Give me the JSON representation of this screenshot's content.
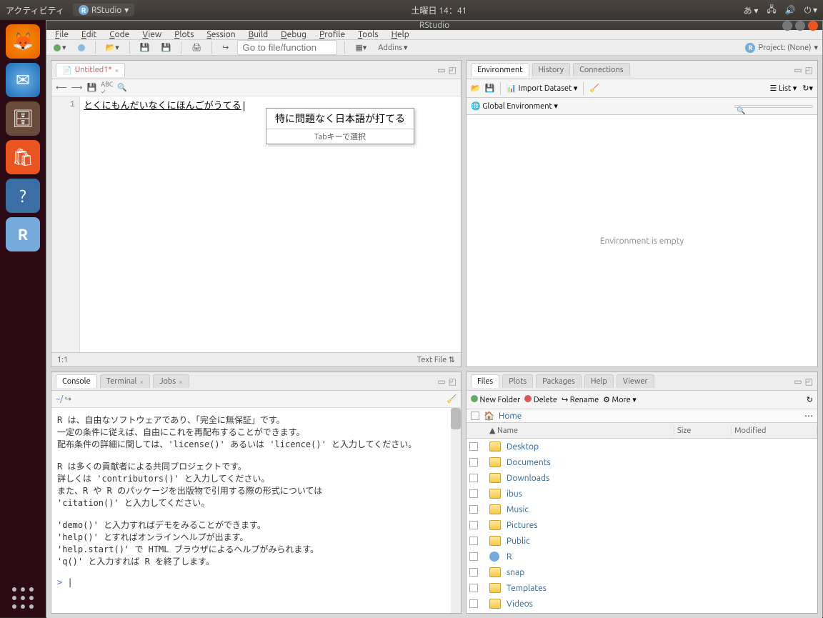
{
  "topbar": {
    "activities": "アクティビティ",
    "app": "RStudio",
    "datetime": "土曜日 14：41",
    "ime": "あ"
  },
  "window": {
    "title": "RStudio"
  },
  "menu": {
    "file": "File",
    "edit": "Edit",
    "code": "Code",
    "view": "View",
    "plots": "Plots",
    "session": "Session",
    "build": "Build",
    "debug": "Debug",
    "profile": "Profile",
    "tools": "Tools",
    "help": "Help"
  },
  "toolbar": {
    "goto_placeholder": "Go to file/function",
    "addins": "Addins",
    "project": "Project: (None)"
  },
  "source": {
    "tab": "Untitled1*",
    "line_no": "1",
    "text": "とくにもんだいなくにほんごがうてる",
    "cursorpos": "1:1",
    "mode": "Text File",
    "ime_candidate": "特に問題なく日本語が打てる",
    "ime_hint": "Tabキーで選択"
  },
  "console": {
    "tab1": "Console",
    "tab2": "Terminal",
    "tab3": "Jobs",
    "cwd": "~/",
    "text": "R は、自由なソフトウェアであり、「完全に無保証」です。\n一定の条件に従えば、自由にこれを再配布することができます。\n配布条件の詳細に関しては、'license()' あるいは 'licence()' と入力してください。\n\nR は多くの貢献者による共同プロジェクトです。\n詳しくは 'contributors()' と入力してください。\nまた、R や R のパッケージを出版物で引用する際の形式については\n'citation()' と入力してください。\n\n'demo()' と入力すればデモをみることができます。\n'help()' とすればオンラインヘルプが出ます。\n'help.start()' で HTML ブラウザによるヘルプがみられます。\n'q()' と入力すれば R を終了します。",
    "prompt": ">"
  },
  "env": {
    "tab1": "Environment",
    "tab2": "History",
    "tab3": "Connections",
    "import": "Import Dataset",
    "globenv": "Global Environment",
    "list": "List",
    "empty": "Environment is empty"
  },
  "files": {
    "tab1": "Files",
    "tab2": "Plots",
    "tab3": "Packages",
    "tab4": "Help",
    "tab5": "Viewer",
    "newfolder": "New Folder",
    "delete": "Delete",
    "rename": "Rename",
    "more": "More",
    "home": "Home",
    "cols": {
      "name": "Name",
      "size": "Size",
      "modified": "Modified"
    },
    "items": [
      "Desktop",
      "Documents",
      "Downloads",
      "ibus",
      "Music",
      "Pictures",
      "Public",
      "R",
      "snap",
      "Templates",
      "Videos"
    ]
  }
}
